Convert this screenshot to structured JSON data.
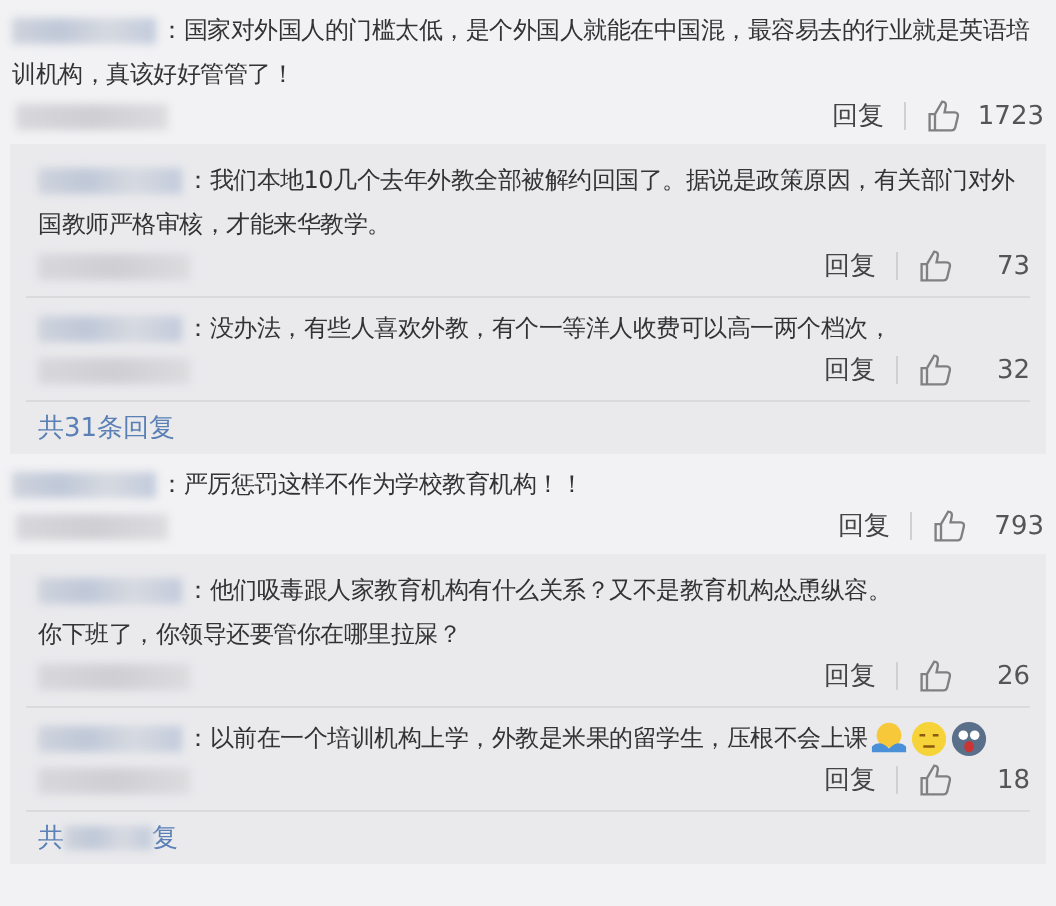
{
  "comments": [
    {
      "lines": [
        "：国家对外国人的门槛太低，是个外国人就能在中国混，最容易去的行业就是英语培",
        "训机构，真该好好管管了！"
      ],
      "reply_label": "回复",
      "likes": "1723",
      "replies": [
        {
          "lines": [
            "：我们本地10几个去年外教全部被解约回国了。据说是政策原因，有关部门对外",
            "国教师严格审核，才能来华教学。"
          ],
          "reply_label": "回复",
          "likes": "73"
        },
        {
          "lines": [
            "：没办法，有些人喜欢外教，有个一等洋人收费可以高一两个档次，"
          ],
          "reply_label": "回复",
          "likes": "32"
        }
      ],
      "more": {
        "start": "共31条回复"
      }
    },
    {
      "lines": [
        "：严厉惩罚这样不作为学校教育机构！！"
      ],
      "reply_label": "回复",
      "likes": "793",
      "replies": [
        {
          "lines": [
            "：他们吸毒跟人家教育机构有什么关系？又不是教育机构怂恿纵容。",
            "你下班了，你领导还要管你在哪里拉屎？"
          ],
          "reply_label": "回复",
          "likes": "26"
        },
        {
          "lines": [
            "：以前在一个培训机构上学，外教是米果的留学生，压根不会上课"
          ],
          "reply_label": "回复",
          "likes": "18",
          "emojis": [
            {
              "kind": "hug"
            },
            {
              "kind": "roll"
            },
            {
              "kind": "shock"
            }
          ]
        }
      ],
      "more": {
        "start": "共",
        "end": "复"
      }
    }
  ]
}
